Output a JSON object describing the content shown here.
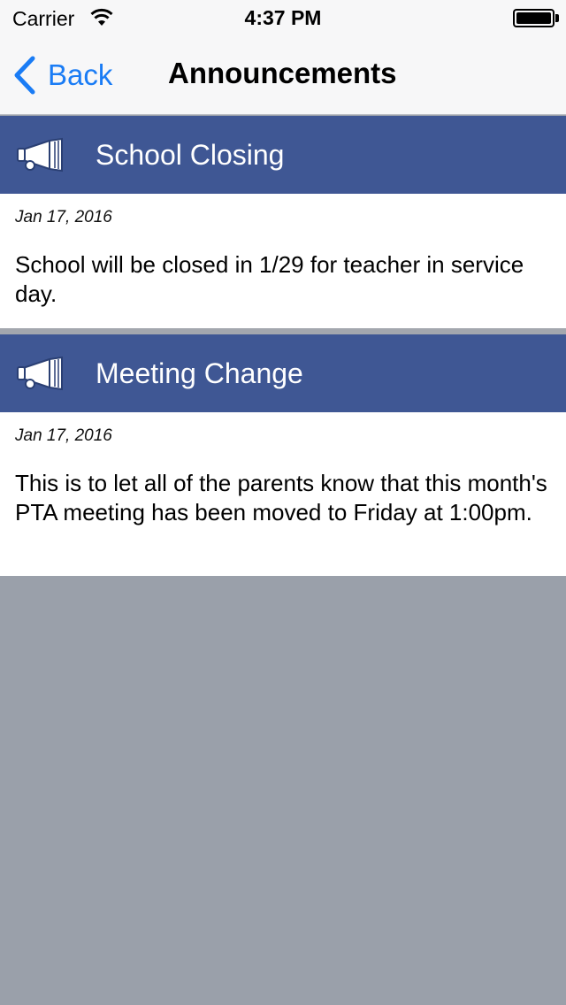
{
  "status_bar": {
    "carrier": "Carrier",
    "time": "4:37 PM",
    "battery_level": 1.0,
    "wifi_icon": "wifi-icon",
    "battery_icon": "battery-icon"
  },
  "nav": {
    "back_label": "Back",
    "title": "Announcements",
    "back_icon": "chevron-left-icon"
  },
  "colors": {
    "header_bg": "#3f5794",
    "accent": "#1a7cf5",
    "background": "#9aa0aa"
  },
  "announcements": [
    {
      "icon": "megaphone-icon",
      "title": "School Closing",
      "date": "Jan 17, 2016",
      "body": "School will be closed in 1/29 for teacher in service day."
    },
    {
      "icon": "megaphone-icon",
      "title": "Meeting Change",
      "date": "Jan 17, 2016",
      "body": "This is to let all of the parents know that this month's PTA meeting has been moved to Friday at 1:00pm."
    }
  ]
}
